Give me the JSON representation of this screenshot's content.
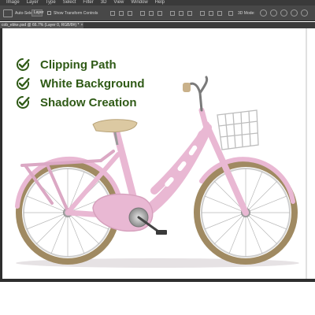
{
  "menubar": {
    "items": [
      "Image",
      "Layer",
      "Type",
      "Select",
      "Filter",
      "3D",
      "View",
      "Window",
      "Help"
    ]
  },
  "options_bar": {
    "auto_select_label": "Auto-Select:",
    "auto_select_value": "Layer",
    "show_transform_label": "Show Transform Controls",
    "mode_label": "3D Mode:"
  },
  "document_tab": {
    "title": "cob_ebke.psd @ 66.7% (Layer 0, RGB/8#) *",
    "close_glyph": "×"
  },
  "features": [
    {
      "label": "Clipping Path",
      "icon": "check-icon"
    },
    {
      "label": "White Background",
      "icon": "check-icon"
    },
    {
      "label": "Shadow Creation",
      "icon": "check-icon"
    }
  ],
  "colors": {
    "check_green": "#2f5a16",
    "bike_pink": "#e9b8d3",
    "tire_tan": "#a08a62"
  }
}
